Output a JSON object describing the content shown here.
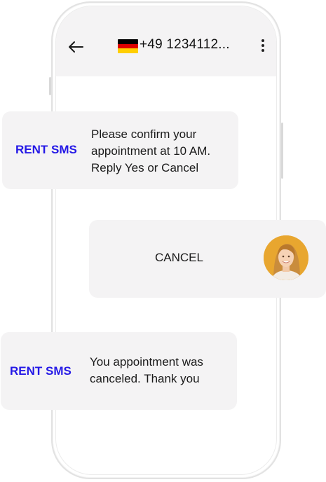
{
  "header": {
    "contact": "+49 1234112...",
    "flag": {
      "colors": [
        "#000000",
        "#dd0000",
        "#ffce00"
      ]
    }
  },
  "messages": [
    {
      "sender": "RENT SMS",
      "text": "Please confirm your\nappointment at 10 AM.\nReply Yes or Cancel"
    },
    {
      "text": "CANCEL"
    },
    {
      "sender": "RENT SMS",
      "text": "You appointment was\ncanceled. Thank you"
    }
  ],
  "colors": {
    "sender": "#2418e6",
    "bubble": "#f4f3f4",
    "header": "#f4f3f4",
    "avatar_bg": "#e8a62f"
  },
  "icons": [
    "back-arrow-icon",
    "more-vertical-icon",
    "germany-flag-icon",
    "user-avatar"
  ]
}
